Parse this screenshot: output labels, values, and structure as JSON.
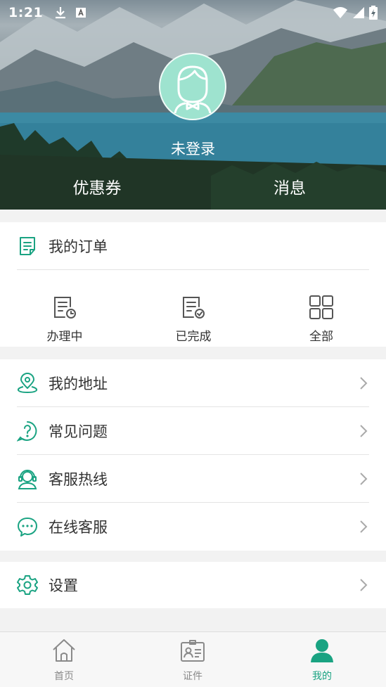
{
  "status_bar": {
    "time": "1:21"
  },
  "profile": {
    "login_status": "未登录",
    "coupons_label": "优惠券",
    "messages_label": "消息"
  },
  "orders": {
    "title": "我的订单",
    "tabs": [
      {
        "label": "办理中",
        "icon": "doc-clock-icon"
      },
      {
        "label": "已完成",
        "icon": "doc-check-icon"
      },
      {
        "label": "全部",
        "icon": "grid-icon"
      }
    ]
  },
  "menu": {
    "items": [
      {
        "label": "我的地址",
        "icon": "location-pin-icon"
      },
      {
        "label": "常见问题",
        "icon": "question-icon"
      },
      {
        "label": "客服热线",
        "icon": "headset-icon"
      },
      {
        "label": "在线客服",
        "icon": "chat-bubble-icon"
      }
    ]
  },
  "settings": {
    "label": "设置",
    "icon": "gear-icon"
  },
  "bottom_nav": {
    "items": [
      {
        "label": "首页",
        "icon": "home-icon",
        "active": false
      },
      {
        "label": "证件",
        "icon": "id-card-icon",
        "active": false
      },
      {
        "label": "我的",
        "icon": "person-icon",
        "active": true
      }
    ]
  },
  "colors": {
    "accent": "#1aa382",
    "avatar_bg": "#9ee3cf",
    "inactive": "#8a8a8a"
  }
}
